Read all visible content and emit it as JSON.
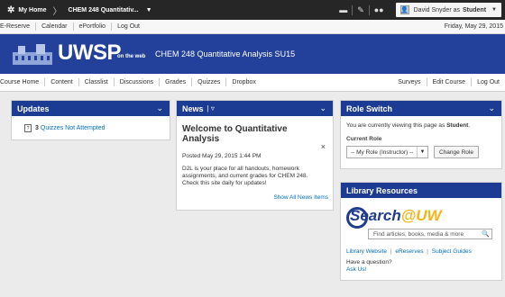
{
  "minibar": {
    "home_icon": "org-home-icon",
    "home_label": "My Home",
    "course": "CHEM 248 Quantitativ...",
    "icons": [
      "message-icon",
      "subscription-icon",
      "update-icon"
    ],
    "user_name": "David Snyder as",
    "user_role": "Student"
  },
  "linkbar": {
    "links": [
      "E-Reserve",
      "Calendar",
      "ePortfolio",
      "Log Out"
    ],
    "date": "Friday, May 29, 2015"
  },
  "banner": {
    "logo_text": "UWSP",
    "logo_sub": "on the web",
    "course_title": "CHEM 248 Quantitative Analysis SU15",
    "colors": {
      "banner": "#23409a",
      "widget_header": "#1c3c94",
      "link": "#006fbf",
      "accent": "#f5b512"
    }
  },
  "navbar": {
    "left": [
      "Course Home",
      "Content",
      "Classlist",
      "Discussions",
      "Grades",
      "Quizzes",
      "Dropbox"
    ],
    "right": [
      "Surveys",
      "Edit Course",
      "Log Out"
    ]
  },
  "updates": {
    "title": "Updates",
    "count": "3",
    "item": "Quizzes Not Attempted"
  },
  "news": {
    "title": "News",
    "headline": "Welcome to Quantitative Analysis",
    "posted": "Posted May 29, 2015 1:44 PM",
    "body": "D2L is your place for all handouts, homework assignments, and current grades for CHEM 248. Check this site daily for updates!",
    "show_all": "Show All News Items"
  },
  "role_switch": {
    "title": "Role Switch",
    "text_prefix": "You are currently viewing this page as",
    "text_role": "Student",
    "current_role_label": "Current Role",
    "selected_role": "-- My Role (Instructor) --",
    "button": "Change Role"
  },
  "library": {
    "title": "Library Resources",
    "logo_search": "Search",
    "logo_uw": "@UW",
    "search_placeholder": "Find articles, books, media & more",
    "link_website": "Library Website",
    "link_ereserves": "eReserves",
    "link_guides": "Subject Guides",
    "question": "Have a question?",
    "ask": "Ask Us!"
  }
}
